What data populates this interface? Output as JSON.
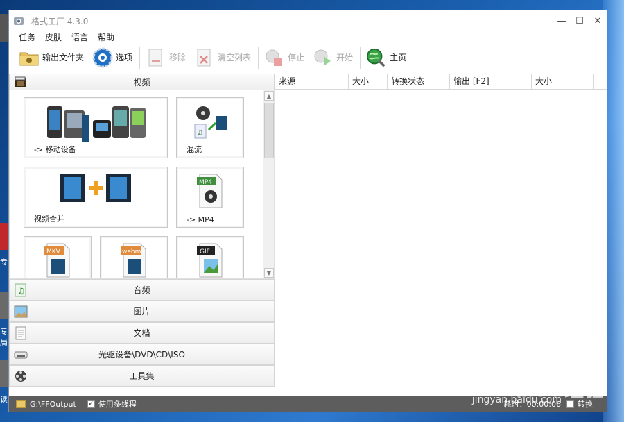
{
  "window": {
    "title": "格式工厂 4.3.0"
  },
  "desktop": {
    "left_texts": [
      "专",
      "专",
      "局)",
      "读"
    ]
  },
  "menu": [
    "任务",
    "皮肤",
    "语言",
    "帮助"
  ],
  "toolbar": {
    "output_folder": "输出文件夹",
    "options": "选项",
    "remove": "移除",
    "clear_list": "清空列表",
    "stop": "停止",
    "start": "开始",
    "home": "主页"
  },
  "categories": {
    "video": "视频",
    "audio": "音频",
    "image": "图片",
    "document": "文档",
    "optical": "光驱设备\\DVD\\CD\\ISO",
    "tools": "工具集"
  },
  "video_tiles": {
    "mobile": "-> 移动设备",
    "mux": "混流",
    "join": "视频合并",
    "mp4": "-> MP4",
    "mp4_badge": "MP4",
    "mkv_badge": "MKV",
    "webm_badge": "webm",
    "gif_badge": "GIF"
  },
  "table": {
    "columns": [
      "来源",
      "大小",
      "转换状态",
      "输出 [F2]",
      "大小"
    ]
  },
  "status": {
    "output_path": "G:\\FFOutput",
    "multithread_label": "使用多线程",
    "elapsed": "耗时：00:00:06",
    "after_convert": "转换",
    "watermark": "Baidu经验",
    "watermark_url": "jingyan.baidu.com"
  },
  "colors": {
    "statusbar": "#5d5d5d",
    "accent": "#2f7ad0"
  }
}
